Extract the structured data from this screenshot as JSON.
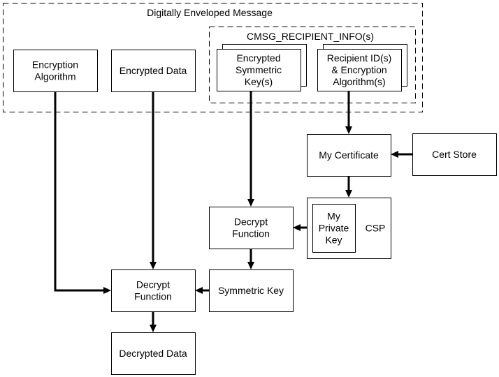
{
  "diagram": {
    "groups": {
      "envelope": {
        "label": "Digitally Enveloped Message"
      },
      "recipient_info": {
        "label": "CMSG_RECIPIENT_INFO(s)"
      }
    },
    "nodes": {
      "encryption_algorithm": {
        "lines": [
          "Encryption",
          "Algorithm"
        ]
      },
      "encrypted_data": {
        "lines": [
          "Encrypted Data"
        ]
      },
      "encrypted_symmetric_keys": {
        "lines": [
          "Encrypted",
          "Symmetric",
          "Key(s)"
        ]
      },
      "recipient_ids": {
        "lines": [
          "Recipient ID(s)",
          "& Encryption",
          "Algorithm(s)"
        ]
      },
      "my_certificate": {
        "lines": [
          "My Certificate"
        ]
      },
      "cert_store": {
        "lines": [
          "Cert Store"
        ]
      },
      "csp": {
        "lines": [
          "CSP"
        ]
      },
      "my_private_key": {
        "lines": [
          "My",
          "Private",
          "Key"
        ]
      },
      "decrypt_function_key": {
        "lines": [
          "Decrypt",
          "Function"
        ]
      },
      "symmetric_key": {
        "lines": [
          "Symmetric Key"
        ]
      },
      "decrypt_function_data": {
        "lines": [
          "Decrypt",
          "Function"
        ]
      },
      "decrypted_data": {
        "lines": [
          "Decrypted Data"
        ]
      }
    },
    "edges": [
      {
        "from": "recipient_ids",
        "to": "my_certificate"
      },
      {
        "from": "cert_store",
        "to": "my_certificate"
      },
      {
        "from": "my_certificate",
        "to": "csp"
      },
      {
        "from": "my_private_key",
        "to": "decrypt_function_key"
      },
      {
        "from": "encrypted_symmetric_keys",
        "to": "decrypt_function_key"
      },
      {
        "from": "decrypt_function_key",
        "to": "symmetric_key"
      },
      {
        "from": "symmetric_key",
        "to": "decrypt_function_data"
      },
      {
        "from": "encrypted_data",
        "to": "decrypt_function_data"
      },
      {
        "from": "encryption_algorithm",
        "to": "decrypt_function_data"
      },
      {
        "from": "decrypt_function_data",
        "to": "decrypted_data"
      }
    ]
  }
}
